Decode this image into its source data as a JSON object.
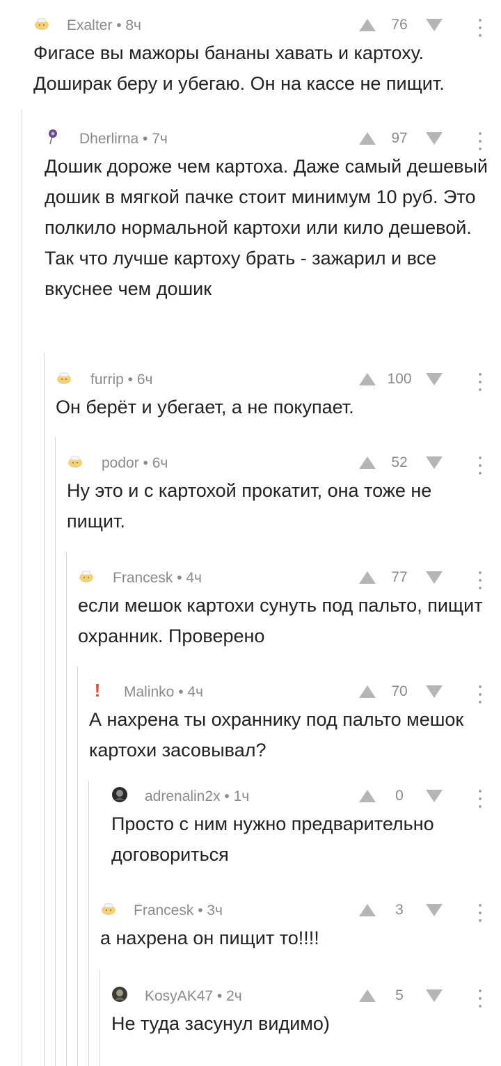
{
  "comments": [
    {
      "author": "Exalter • 8ч",
      "rating": "76",
      "avatar": "default-avatar-icon",
      "text": "Фигасе вы мажоры бананы хавать и картоху. Доширак беру и убегаю. Он на кассе не пищит."
    },
    {
      "author": "Dherlirna • 7ч",
      "rating": "97",
      "avatar": "flower-avatar-icon",
      "text": "Дошик дороже чем картоха. Даже самый дешевый дошик в мягкой пачке стоит минимум 10 руб. Это полкило нормальной картохи или кило дешевой. Так что лучше картоху брать - зажарил и все вкуснее чем дошик"
    },
    {
      "author": "furrip • 6ч",
      "rating": "100",
      "avatar": "default-avatar-icon",
      "text": "Он берёт и убегает, а не покупает."
    },
    {
      "author": "podor • 6ч",
      "rating": "52",
      "avatar": "default-avatar-icon",
      "text": "Ну это и с картохой прокатит, она тоже не пищит."
    },
    {
      "author": "Francesk • 4ч",
      "rating": "77",
      "avatar": "default-avatar-icon",
      "text": "если мешок картохи сунуть под пальто, пищит охранник. Проверено"
    },
    {
      "author": "Malinko • 4ч",
      "rating": "70",
      "avatar": "exclamation-avatar-icon",
      "avatar_glyph": "!",
      "text": "А нахрена ты охраннику под пальто мешок картохи засовывал?"
    },
    {
      "author": "adrenalin2x • 1ч",
      "rating": "0",
      "avatar": "photo-avatar-icon",
      "text": "Просто с ним нужно предварительно договориться"
    },
    {
      "author": "Francesk • 3ч",
      "rating": "3",
      "avatar": "default-avatar-icon",
      "text": "а нахрена он пищит то!!!!"
    },
    {
      "author": "KosyAK47 • 2ч",
      "rating": "5",
      "avatar": "photo-avatar-icon",
      "text": "Не туда засунул видимо)"
    }
  ],
  "colors": {
    "text": "#222222",
    "meta": "#8a8a8a",
    "thread_line": "#d6d6d6",
    "vote_icon": "#b5b5b5",
    "accent_red": "#e0483d"
  }
}
